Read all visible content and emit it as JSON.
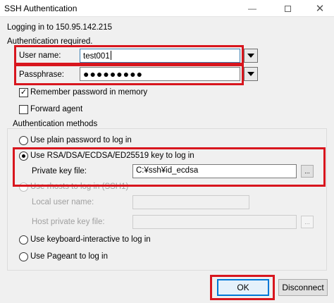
{
  "window": {
    "title": "SSH Authentication",
    "minimize_glyph": "—",
    "close_glyph": "✕"
  },
  "header": {
    "logging_in": "Logging in to 150.95.142.215",
    "auth_required": "Authentication required."
  },
  "credentials": {
    "username_label": "User name:",
    "username_value": "test001",
    "passphrase_label": "Passphrase:",
    "passphrase_value": "●●●●●●●●●"
  },
  "options": {
    "remember_label": "Remember password in memory",
    "remember_checked": true,
    "remember_glyph": "✓",
    "forward_label": "Forward agent",
    "forward_checked": false
  },
  "methods": {
    "group_label": "Authentication methods",
    "plain_label": "Use plain password to log in",
    "key_label": "Use RSA/DSA/ECDSA/ED25519 key to log in",
    "private_key_label": "Private key file:",
    "private_key_value": "C:¥ssh¥id_ecdsa",
    "rhosts_label": "Use rhosts to log in (SSH1)",
    "local_user_label": "Local user name:",
    "host_key_label": "Host private key file:",
    "keyboard_label": "Use keyboard-interactive to log in",
    "pageant_label": "Use Pageant to log in",
    "selected": "key",
    "browse_label": "..."
  },
  "buttons": {
    "ok": "OK",
    "disconnect": "Disconnect"
  },
  "colors": {
    "highlight": "#d8161e",
    "default_button_border": "#0078d7"
  },
  "icons": {
    "dropdown": "chevron-down-icon",
    "minimize": "minimize-icon",
    "maximize": "maximize-icon",
    "close": "close-icon"
  }
}
